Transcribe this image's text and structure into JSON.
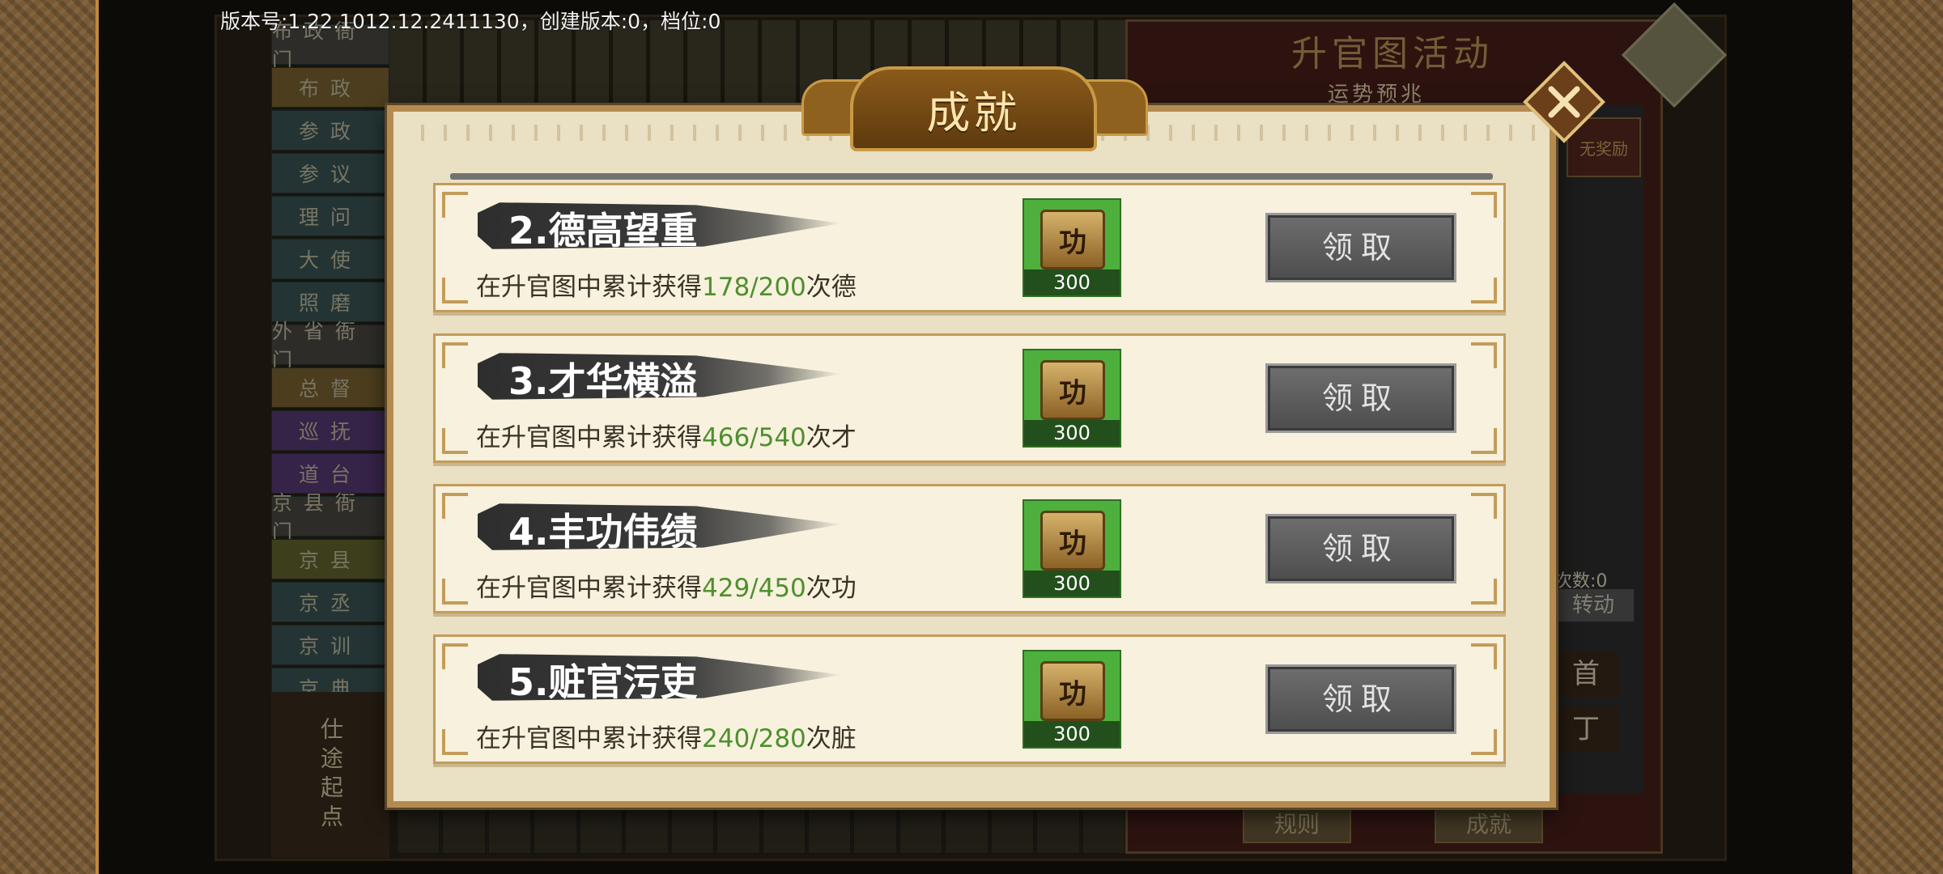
{
  "version_text": "版本号:1.22.1012.12.2411130，创建版本:0，档位:0",
  "modal": {
    "title": "成就",
    "achievements": [
      {
        "title": "2.德高望重",
        "desc_prefix": "在升官图中累计获得",
        "progress": "178/200",
        "desc_suffix": "次德",
        "reward_icon": "功",
        "reward_count": "300",
        "button": "领取"
      },
      {
        "title": "3.才华横溢",
        "desc_prefix": "在升官图中累计获得",
        "progress": "466/540",
        "desc_suffix": "次才",
        "reward_icon": "功",
        "reward_count": "300",
        "button": "领取"
      },
      {
        "title": "4.丰功伟绩",
        "desc_prefix": "在升官图中累计获得",
        "progress": "429/450",
        "desc_suffix": "次功",
        "reward_icon": "功",
        "reward_count": "300",
        "button": "领取"
      },
      {
        "title": "5.赃官污吏",
        "desc_prefix": "在升官图中累计获得",
        "progress": "240/280",
        "desc_suffix": "次脏",
        "reward_icon": "功",
        "reward_count": "300",
        "button": "领取"
      }
    ]
  },
  "background": {
    "right_title": "升官图活动",
    "right_subtitle": "运势预兆",
    "top_right_pill": "无奖励",
    "side_count_label": "次数:0",
    "side_button": "转动",
    "side_big_a": "首",
    "side_big_b": "丁",
    "bottom_btn_rules": "规则",
    "bottom_btn_achievement": "成就",
    "rank_items": [
      "布政衙门",
      "布政",
      "参政",
      "参议",
      "理问",
      "大使",
      "照磨",
      "外省衙门",
      "总督",
      "巡抚",
      "道台",
      "京县衙门",
      "京县",
      "京丞",
      "京训",
      "京典"
    ],
    "rank_bottom": "仕途起点"
  },
  "colors": {
    "modal_bg": "#eae0c4",
    "progress_green": "#4f8f2e",
    "reward_bg": "#4db03c",
    "button_gray": "#5a5a5a"
  },
  "icons": {
    "close": "close-icon",
    "reward": "merit-token-icon"
  }
}
